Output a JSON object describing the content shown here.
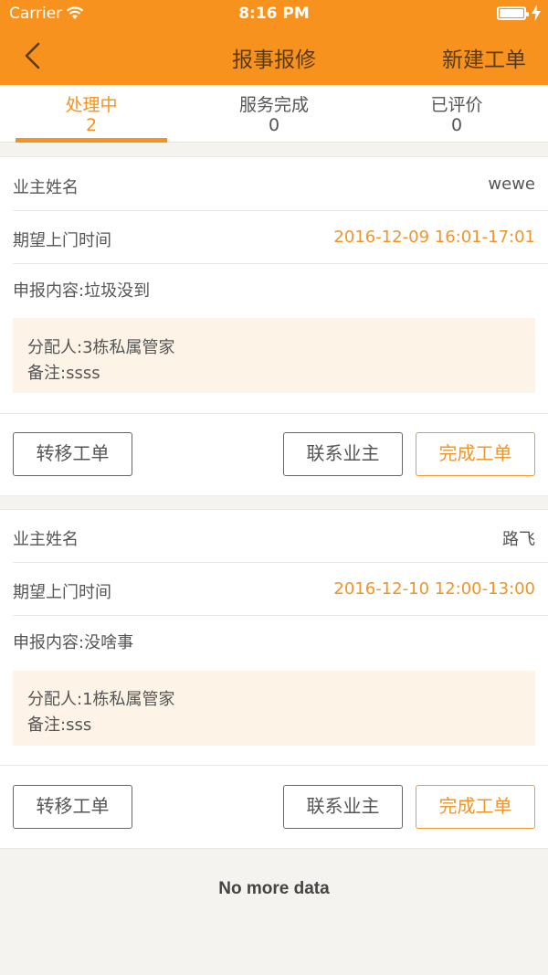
{
  "status_bar": {
    "carrier": "Carrier",
    "time": "8:16 PM"
  },
  "nav": {
    "title": "报事报修",
    "right_action": "新建工单"
  },
  "tabs": [
    {
      "label": "处理中",
      "count": "2"
    },
    {
      "label": "服务完成",
      "count": "0"
    },
    {
      "label": "已评价",
      "count": "0"
    }
  ],
  "orders": [
    {
      "owner_label": "业主姓名",
      "owner_value": "wewe",
      "time_label": "期望上门时间",
      "time_value": "2016-12-09 16:01-17:01",
      "content": "申报内容:垃圾没到",
      "assignee": "分配人:3栋私属管家",
      "remark": "备注:ssss",
      "transfer_label": "转移工单",
      "contact_label": "联系业主",
      "complete_label": "完成工单"
    },
    {
      "owner_label": "业主姓名",
      "owner_value": "路飞",
      "time_label": "期望上门时间",
      "time_value": "2016-12-10 12:00-13:00",
      "content": "申报内容:没啥事",
      "assignee": "分配人:1栋私属管家",
      "remark": "备注:sss",
      "transfer_label": "转移工单",
      "contact_label": "联系业主",
      "complete_label": "完成工单"
    }
  ],
  "footer": {
    "no_more": "No more data"
  },
  "colors": {
    "accent": "#f7921e",
    "background": "#f4f3ef",
    "highlight_box": "#fdf3e6"
  }
}
